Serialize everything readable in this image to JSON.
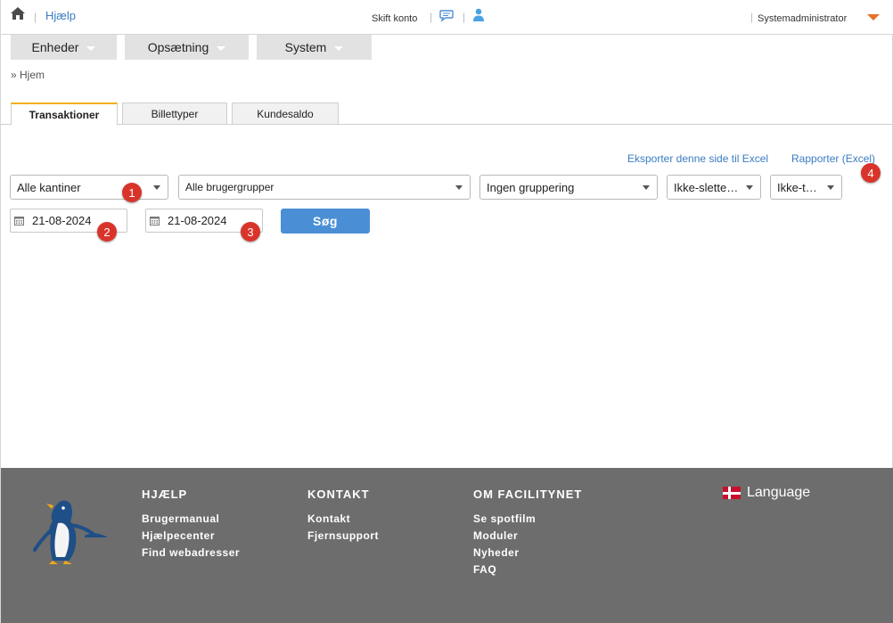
{
  "topbar": {
    "help_label": "Hjælp",
    "switch_account": "Skift konto",
    "user_name": "Systemadministrator",
    "separator": "|"
  },
  "menu": [
    {
      "label": "Enheder"
    },
    {
      "label": "Opsætning"
    },
    {
      "label": "System"
    }
  ],
  "breadcrumb": "» Hjem",
  "tabs": [
    {
      "label": "Transaktioner",
      "active": true
    },
    {
      "label": "Billettyper",
      "active": false
    },
    {
      "label": "Kundesaldo",
      "active": false
    }
  ],
  "links": {
    "export": "Eksporter denne side til Excel",
    "report": "Rapporter (Excel)"
  },
  "filters": {
    "canteen": "Alle kantiner",
    "user_group": "Alle brugergrupper",
    "grouping": "Ingen gruppering",
    "deleted": "Ikke-slette…",
    "type": "Ikke-t…"
  },
  "dates": {
    "from": "21-08-2024",
    "to": "21-08-2024"
  },
  "search_label": "Søg",
  "badges": [
    "1",
    "2",
    "3",
    "4"
  ],
  "footer": {
    "col1": {
      "heading": "HJÆLP",
      "items": [
        "Brugermanual",
        "Hjælpecenter",
        "Find webadresser"
      ]
    },
    "col2": {
      "heading": "KONTAKT",
      "items": [
        "Kontakt",
        "Fjernsupport"
      ]
    },
    "col3": {
      "heading": "OM FACILITYNET",
      "items": [
        "Se spotfilm",
        "Moduler",
        "Nyheder",
        "FAQ"
      ]
    },
    "language": "Language"
  },
  "colors": {
    "accent_blue": "#4a8fd6",
    "link_blue": "#3a7cc2",
    "badge_red": "#d9342b",
    "footer_gray": "#6d6d6d",
    "tab_active_border": "#f2b01e",
    "user_caret": "#e8702a"
  }
}
